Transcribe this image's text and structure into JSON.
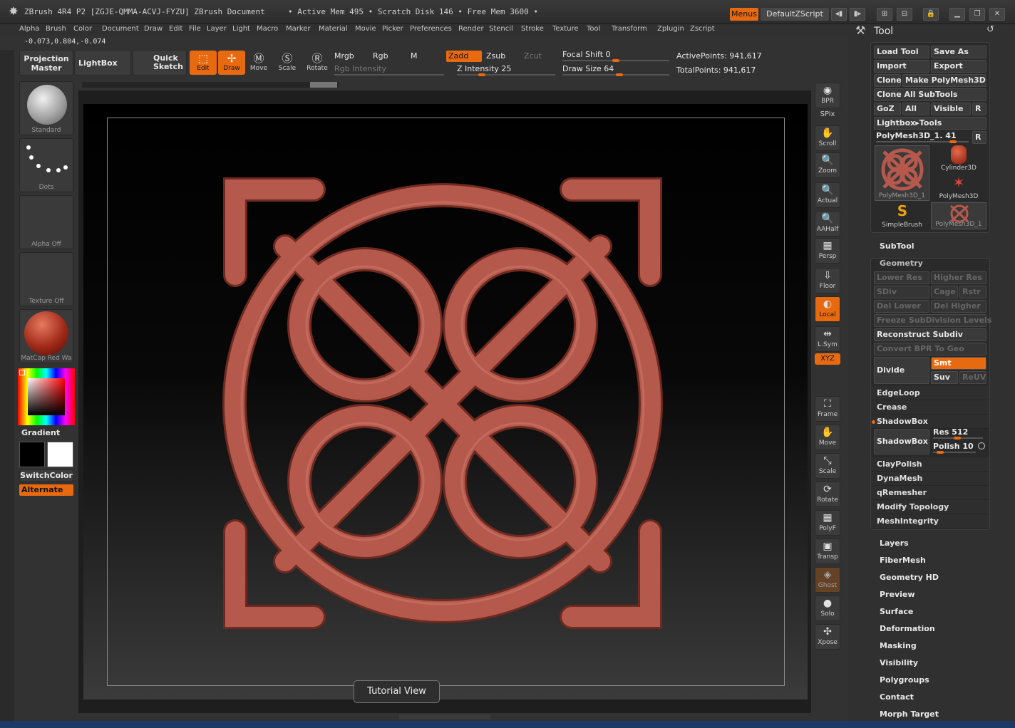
{
  "title_bar": {
    "title": "ZBrush 4R4 P2 [ZGJE-QMMA-ACVJ-FYZU]    ZBrush Document",
    "memory": "• Active Mem 495 • Scratch Disk 146 • Free Mem 3600 •",
    "menus_label": "Menus",
    "script_label": "DefaultZScript"
  },
  "menu_bar": [
    "Alpha",
    "Brush",
    "Color",
    "Document",
    "Draw",
    "Edit",
    "File",
    "Layer",
    "Light",
    "Macro",
    "Marker",
    "Material",
    "Movie",
    "Picker",
    "Preferences",
    "Render",
    "Stencil",
    "Stroke",
    "Texture",
    "Tool",
    "Transform",
    "Zplugin",
    "Zscript"
  ],
  "coords": "-0.073,0.804,-0.074",
  "shelf": {
    "projection_master": "Projection Master",
    "lightbox": "LightBox",
    "quick_sketch": "Quick Sketch",
    "edit": "Edit",
    "draw": "Draw",
    "move": "Move",
    "scale": "Scale",
    "rotate": "Rotate",
    "mrgb": "Mrgb",
    "rgb": "Rgb",
    "m": "M",
    "zadd": "Zadd",
    "zsub": "Zsub",
    "zcut": "Zcut",
    "rgb_intensity": "Rgb Intensity",
    "z_intensity": "Z Intensity 25",
    "focal_shift": "Focal Shift 0",
    "draw_size": "Draw Size 64",
    "z_intensity_value": 25,
    "draw_size_value": 64,
    "focal_shift_value": 0,
    "active_points": "ActivePoints: 941,617",
    "total_points": "TotalPoints: 941,617"
  },
  "left_col": {
    "brush": "Standard",
    "stroke": "Dots",
    "alpha": "Alpha Off",
    "texture": "Texture Off",
    "material": "MatCap Red Wa",
    "gradient": "Gradient",
    "switch_color": "SwitchColor",
    "alternate": "Alternate"
  },
  "right_strip": [
    {
      "name": "bpr",
      "label": "BPR"
    },
    {
      "name": "spix",
      "label": "SPix"
    },
    {
      "name": "scroll",
      "label": "Scroll"
    },
    {
      "name": "zoom",
      "label": "Zoom"
    },
    {
      "name": "actual",
      "label": "Actual"
    },
    {
      "name": "aahalf",
      "label": "AAHalf"
    },
    {
      "name": "persp",
      "label": "Persp"
    },
    {
      "name": "floor",
      "label": "Floor"
    },
    {
      "name": "local",
      "label": "Local"
    },
    {
      "name": "lsym",
      "label": "L.Sym"
    },
    {
      "name": "xyz",
      "label": "XYZ"
    },
    {
      "name": "frame",
      "label": "Frame"
    },
    {
      "name": "move",
      "label": "Move"
    },
    {
      "name": "scale",
      "label": "Scale"
    },
    {
      "name": "rotate",
      "label": "Rotate"
    },
    {
      "name": "polyf",
      "label": "PolyF"
    },
    {
      "name": "transp",
      "label": "Transp"
    },
    {
      "name": "ghost",
      "label": "Ghost"
    },
    {
      "name": "solo",
      "label": "Solo"
    },
    {
      "name": "xpose",
      "label": "Xpose"
    }
  ],
  "tutorial": "Tutorial View",
  "tool_panel": {
    "title": "Tool",
    "load_tool": "Load Tool",
    "save_as": "Save As",
    "import": "Import",
    "export": "Export",
    "clone": "Clone",
    "make_polymesh": "Make PolyMesh3D",
    "clone_all": "Clone All SubTools",
    "goz": "GoZ",
    "all": "All",
    "visible": "Visible",
    "r": "R",
    "lightbox_tools": "Lightbox▸Tools",
    "current_tool": "PolyMesh3D_1. 41",
    "thumbs": [
      "PolyMesh3D_1",
      "Cylinder3D",
      "PolyMesh3D",
      "SimpleBrush",
      "PolyMesh3D_1"
    ],
    "subtool": "SubTool",
    "geometry": "Geometry",
    "lower_res": "Lower Res",
    "higher_res": "Higher Res",
    "sdiv": "SDiv",
    "cage": "Cage",
    "rstr": "Rstr",
    "del_lower": "Del Lower",
    "del_higher": "Del Higher",
    "freeze": "Freeze SubDivision Levels",
    "reconstruct": "Reconstruct Subdiv",
    "convert_bpr": "Convert BPR To Geo",
    "divide": "Divide",
    "smt": "Smt",
    "suv": "Suv",
    "reuv": "ReUV",
    "edgeloop": "EdgeLoop",
    "crease": "Crease",
    "shadowbox_head": "ShadowBox",
    "shadowbox": "ShadowBox",
    "res": "Res 512",
    "polish": "Polish 10",
    "claypolish": "ClayPolish",
    "dynamesh": "DynaMesh",
    "qremesher": "qRemesher",
    "modify_topology": "Modify Topology",
    "meshintegrity": "MeshIntegrity",
    "sections": [
      "Layers",
      "FiberMesh",
      "Geometry HD",
      "Preview",
      "Surface",
      "Deformation",
      "Masking",
      "Visibility",
      "Polygroups",
      "Contact",
      "Morph Target"
    ]
  },
  "colors": {
    "accent": "#e86a10",
    "model": "#b5594c"
  }
}
